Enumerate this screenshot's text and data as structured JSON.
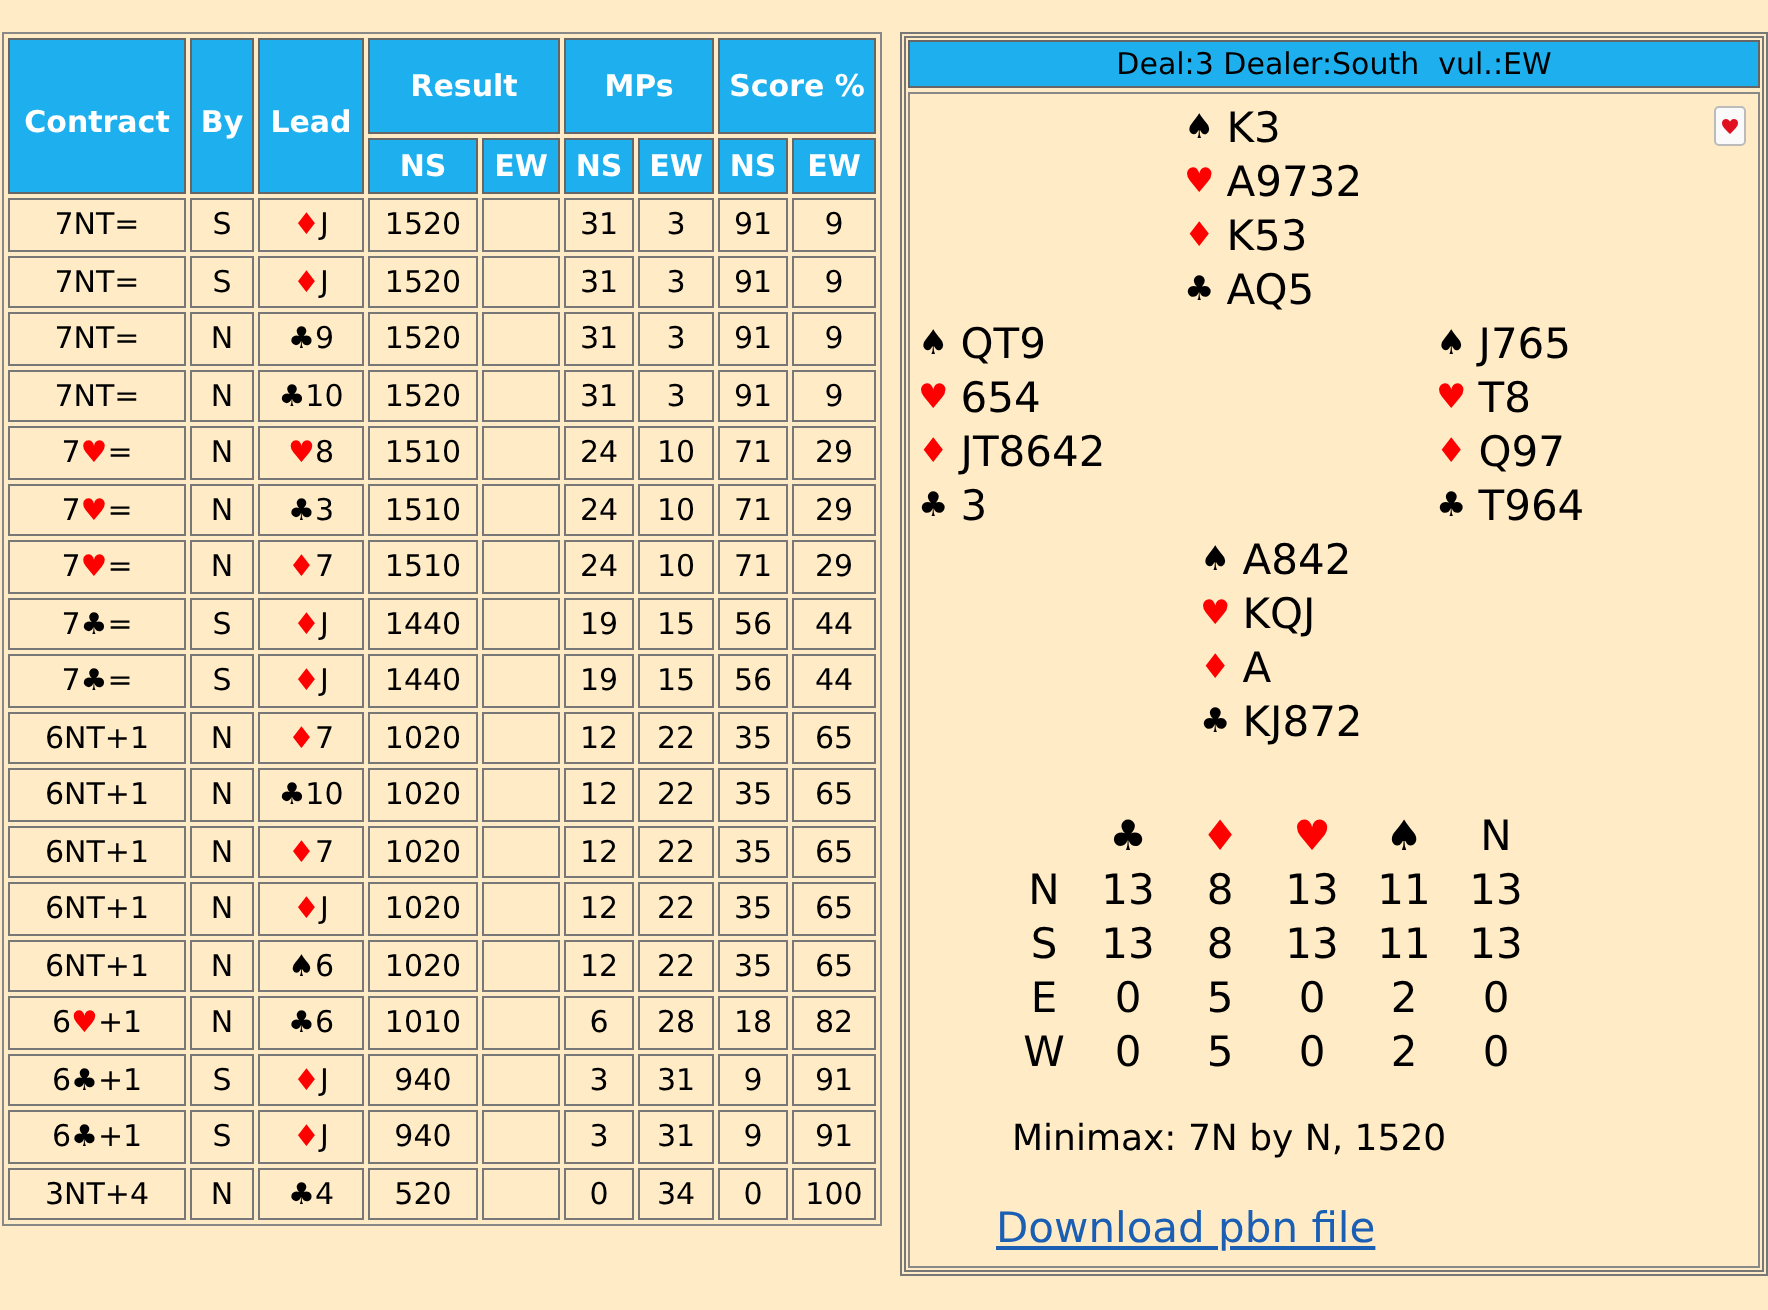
{
  "results_table": {
    "headers": {
      "contract": "Contract",
      "by": "By",
      "lead": "Lead",
      "result": "Result",
      "mps": "MPs",
      "score": "Score %",
      "sub": [
        "NS",
        "EW",
        "NS",
        "EW",
        "NS",
        "EW"
      ]
    },
    "rows": [
      {
        "contract": {
          "text": "7NT="
        },
        "by": "S",
        "lead": {
          "suit": "♦",
          "color": "#ff0000",
          "card": "J"
        },
        "result_ns": "1520",
        "mp_ns": "31",
        "mp_ew": "3",
        "score_ns": "91",
        "score_ew": "9"
      },
      {
        "contract": {
          "text": "7NT="
        },
        "by": "S",
        "lead": {
          "suit": "♦",
          "color": "#ff0000",
          "card": "J"
        },
        "result_ns": "1520",
        "mp_ns": "31",
        "mp_ew": "3",
        "score_ns": "91",
        "score_ew": "9"
      },
      {
        "contract": {
          "text": "7NT="
        },
        "by": "N",
        "lead": {
          "suit": "♣",
          "color": "#000000",
          "card": "9"
        },
        "result_ns": "1520",
        "mp_ns": "31",
        "mp_ew": "3",
        "score_ns": "91",
        "score_ew": "9"
      },
      {
        "contract": {
          "text": "7NT="
        },
        "by": "N",
        "lead": {
          "suit": "♣",
          "color": "#000000",
          "card": "10"
        },
        "result_ns": "1520",
        "mp_ns": "31",
        "mp_ew": "3",
        "score_ns": "91",
        "score_ew": "9"
      },
      {
        "contract": {
          "text": "7",
          "suit": "♥",
          "color": "#ff0000",
          "after": "="
        },
        "by": "N",
        "lead": {
          "suit": "♥",
          "color": "#ff0000",
          "card": "8"
        },
        "result_ns": "1510",
        "mp_ns": "24",
        "mp_ew": "10",
        "score_ns": "71",
        "score_ew": "29"
      },
      {
        "contract": {
          "text": "7",
          "suit": "♥",
          "color": "#ff0000",
          "after": "="
        },
        "by": "N",
        "lead": {
          "suit": "♣",
          "color": "#000000",
          "card": "3"
        },
        "result_ns": "1510",
        "mp_ns": "24",
        "mp_ew": "10",
        "score_ns": "71",
        "score_ew": "29"
      },
      {
        "contract": {
          "text": "7",
          "suit": "♥",
          "color": "#ff0000",
          "after": "="
        },
        "by": "N",
        "lead": {
          "suit": "♦",
          "color": "#ff0000",
          "card": "7"
        },
        "result_ns": "1510",
        "mp_ns": "24",
        "mp_ew": "10",
        "score_ns": "71",
        "score_ew": "29"
      },
      {
        "contract": {
          "text": "7",
          "suit": "♣",
          "color": "#000000",
          "after": "="
        },
        "by": "S",
        "lead": {
          "suit": "♦",
          "color": "#ff0000",
          "card": "J"
        },
        "result_ns": "1440",
        "mp_ns": "19",
        "mp_ew": "15",
        "score_ns": "56",
        "score_ew": "44"
      },
      {
        "contract": {
          "text": "7",
          "suit": "♣",
          "color": "#000000",
          "after": "="
        },
        "by": "S",
        "lead": {
          "suit": "♦",
          "color": "#ff0000",
          "card": "J"
        },
        "result_ns": "1440",
        "mp_ns": "19",
        "mp_ew": "15",
        "score_ns": "56",
        "score_ew": "44"
      },
      {
        "contract": {
          "text": "6NT+1"
        },
        "by": "N",
        "lead": {
          "suit": "♦",
          "color": "#ff0000",
          "card": "7"
        },
        "result_ns": "1020",
        "mp_ns": "12",
        "mp_ew": "22",
        "score_ns": "35",
        "score_ew": "65"
      },
      {
        "contract": {
          "text": "6NT+1"
        },
        "by": "N",
        "lead": {
          "suit": "♣",
          "color": "#000000",
          "card": "10"
        },
        "result_ns": "1020",
        "mp_ns": "12",
        "mp_ew": "22",
        "score_ns": "35",
        "score_ew": "65"
      },
      {
        "contract": {
          "text": "6NT+1"
        },
        "by": "N",
        "lead": {
          "suit": "♦",
          "color": "#ff0000",
          "card": "7"
        },
        "result_ns": "1020",
        "mp_ns": "12",
        "mp_ew": "22",
        "score_ns": "35",
        "score_ew": "65"
      },
      {
        "contract": {
          "text": "6NT+1"
        },
        "by": "N",
        "lead": {
          "suit": "♦",
          "color": "#ff0000",
          "card": "J"
        },
        "result_ns": "1020",
        "mp_ns": "12",
        "mp_ew": "22",
        "score_ns": "35",
        "score_ew": "65"
      },
      {
        "contract": {
          "text": "6NT+1"
        },
        "by": "N",
        "lead": {
          "suit": "♠",
          "color": "#000000",
          "card": "6"
        },
        "result_ns": "1020",
        "mp_ns": "12",
        "mp_ew": "22",
        "score_ns": "35",
        "score_ew": "65"
      },
      {
        "contract": {
          "text": "6",
          "suit": "♥",
          "color": "#ff0000",
          "after": "+1"
        },
        "by": "N",
        "lead": {
          "suit": "♣",
          "color": "#000000",
          "card": "6"
        },
        "result_ns": "1010",
        "mp_ns": "6",
        "mp_ew": "28",
        "score_ns": "18",
        "score_ew": "82"
      },
      {
        "contract": {
          "text": "6",
          "suit": "♣",
          "color": "#000000",
          "after": "+1"
        },
        "by": "S",
        "lead": {
          "suit": "♦",
          "color": "#ff0000",
          "card": "J"
        },
        "result_ns": "940",
        "mp_ns": "3",
        "mp_ew": "31",
        "score_ns": "9",
        "score_ew": "91"
      },
      {
        "contract": {
          "text": "6",
          "suit": "♣",
          "color": "#000000",
          "after": "+1"
        },
        "by": "S",
        "lead": {
          "suit": "♦",
          "color": "#ff0000",
          "card": "J"
        },
        "result_ns": "940",
        "mp_ns": "3",
        "mp_ew": "31",
        "score_ns": "9",
        "score_ew": "91"
      },
      {
        "contract": {
          "text": "3NT+4"
        },
        "by": "N",
        "lead": {
          "suit": "♣",
          "color": "#000000",
          "card": "4"
        },
        "result_ns": "520",
        "mp_ns": "0",
        "mp_ew": "34",
        "score_ns": "0",
        "score_ew": "100"
      }
    ]
  },
  "deal": {
    "title": "Deal:3 Dealer:South  vul.:EW",
    "north": [
      {
        "suit": "♠",
        "color": "#000000",
        "cards": "K3"
      },
      {
        "suit": "♥",
        "color": "#ff0000",
        "cards": "A9732"
      },
      {
        "suit": "♦",
        "color": "#ff0000",
        "cards": "K53"
      },
      {
        "suit": "♣",
        "color": "#000000",
        "cards": "AQ5"
      }
    ],
    "west": [
      {
        "suit": "♠",
        "color": "#000000",
        "cards": "QT9"
      },
      {
        "suit": "♥",
        "color": "#ff0000",
        "cards": "654"
      },
      {
        "suit": "♦",
        "color": "#ff0000",
        "cards": "JT8642"
      },
      {
        "suit": "♣",
        "color": "#000000",
        "cards": "3"
      }
    ],
    "east": [
      {
        "suit": "♠",
        "color": "#000000",
        "cards": "J765"
      },
      {
        "suit": "♥",
        "color": "#ff0000",
        "cards": "T8"
      },
      {
        "suit": "♦",
        "color": "#ff0000",
        "cards": "Q97"
      },
      {
        "suit": "♣",
        "color": "#000000",
        "cards": "T964"
      }
    ],
    "south": [
      {
        "suit": "♠",
        "color": "#000000",
        "cards": "A842"
      },
      {
        "suit": "♥",
        "color": "#ff0000",
        "cards": "KQJ"
      },
      {
        "suit": "♦",
        "color": "#ff0000",
        "cards": "A"
      },
      {
        "suit": "♣",
        "color": "#000000",
        "cards": "KJ872"
      }
    ],
    "double_dummy": {
      "columns": [
        {
          "text": "♣",
          "color": "#000000"
        },
        {
          "text": "♦",
          "color": "#ff0000"
        },
        {
          "text": "♥",
          "color": "#ff0000"
        },
        {
          "text": "♠",
          "color": "#000000"
        },
        {
          "text": "N",
          "color": "#000000"
        }
      ],
      "rows": [
        {
          "seat": "N",
          "values": [
            "13",
            "8",
            "13",
            "11",
            "13"
          ]
        },
        {
          "seat": "S",
          "values": [
            "13",
            "8",
            "13",
            "11",
            "13"
          ]
        },
        {
          "seat": "E",
          "values": [
            "0",
            "5",
            "0",
            "2",
            "0"
          ]
        },
        {
          "seat": "W",
          "values": [
            "0",
            "5",
            "0",
            "2",
            "0"
          ]
        }
      ]
    },
    "minimax": "Minimax: 7N by N, 1520",
    "download_link": "Download pbn file"
  }
}
